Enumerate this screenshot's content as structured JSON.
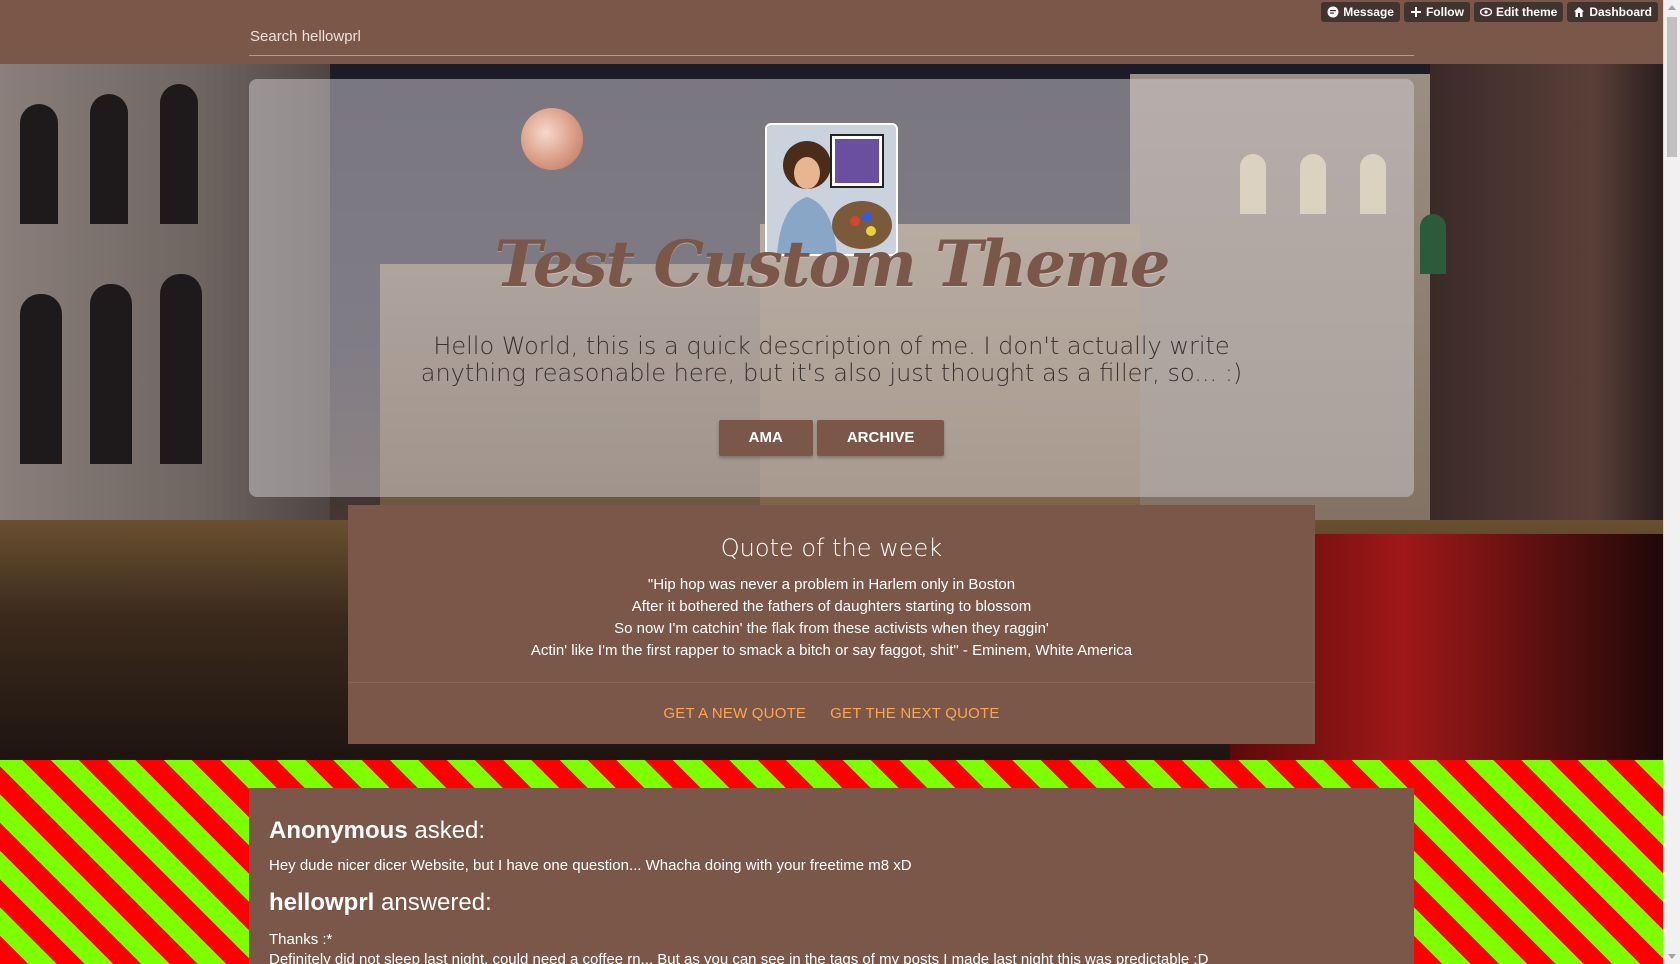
{
  "controls": {
    "message_label": "Message",
    "follow_label": "Follow",
    "edit_theme_label": "Edit theme",
    "dashboard_label": "Dashboard"
  },
  "search": {
    "placeholder": "Search hellowprl"
  },
  "hero": {
    "title": "Test Custom Theme",
    "description": "Hello World, this is a quick description of me. I don't actually write anything reasonable here, but it's also just thought as a filler, so... :)",
    "buttons": [
      {
        "label": "AMA"
      },
      {
        "label": "ARCHIVE"
      }
    ]
  },
  "quote": {
    "title": "Quote of the week",
    "lines": [
      "\"Hip hop was never a problem in Harlem only in Boston",
      "After it bothered the fathers of daughters starting to blossom",
      "So now I'm catchin' the flak from these activists when they raggin'",
      "Actin' like I'm the first rapper to smack a bitch or say faggot, shit\" - Eminem, White America"
    ],
    "new_quote_label": "GET A NEW QUOTE",
    "next_quote_label": "GET THE NEXT QUOTE"
  },
  "post": {
    "asker": "Anonymous",
    "asked_label": "asked:",
    "question": "Hey dude nicer dicer Website, but I have one question... Whacha doing with your freetime m8 xD",
    "answerer": "hellowprl",
    "answered_label": "answered:",
    "answer_line1": "Thanks :*",
    "answer_line2": "Definitely did not sleep last night, could need a coffee rn... But as you can see in the tags of my posts I made last night this was predictable :D"
  },
  "colors": {
    "accent": "#7a5748",
    "link": "#ffa64d",
    "stripe_red": "#ff0000",
    "stripe_green": "#7dff00"
  }
}
